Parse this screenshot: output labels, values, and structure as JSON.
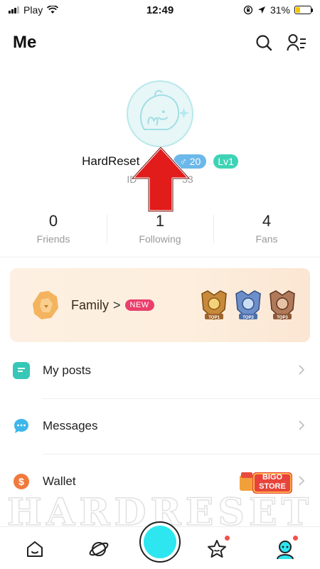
{
  "status_bar": {
    "carrier": "Play",
    "time": "12:49",
    "battery": "31%",
    "battery_level": 0.31
  },
  "header": {
    "title": "Me",
    "search_icon": "search-icon",
    "profile_menu_icon": "profile-list-icon"
  },
  "profile": {
    "username": "HardReset",
    "age_badge": "♂ 20",
    "level_badge": "Lv1",
    "id_left": "ID",
    "id_right": "33"
  },
  "stats": [
    {
      "value": "0",
      "label": "Friends"
    },
    {
      "value": "1",
      "label": "Following"
    },
    {
      "value": "4",
      "label": "Fans"
    }
  ],
  "family": {
    "label": "Family",
    "chevron": ">",
    "new_badge": "NEW",
    "trophies": [
      "TOP1",
      "TOP2",
      "TOP3"
    ]
  },
  "menu": [
    {
      "label": "My posts",
      "icon": "posts-icon",
      "color": "#36c7b7"
    },
    {
      "label": "Messages",
      "icon": "chat-bubble-icon",
      "color": "#3fb6ea"
    },
    {
      "label": "Wallet",
      "icon": "dollar-coin-icon",
      "color": "#f07a3d"
    }
  ],
  "bigo_store": {
    "line1": "BIGO",
    "line2": "STORE"
  },
  "watermark": "HARDRESET",
  "nav": [
    {
      "icon": "home-icon"
    },
    {
      "icon": "planet-icon"
    },
    {
      "icon": "live-button-icon"
    },
    {
      "icon": "star-face-icon"
    },
    {
      "icon": "me-avatar-icon"
    }
  ],
  "colors": {
    "accent": "#2ee6f0",
    "age_badge": "#6bb8ea",
    "level_badge": "#3fd3b6",
    "new_badge": "#ea3f6c",
    "arrow": "#e21b1b"
  }
}
